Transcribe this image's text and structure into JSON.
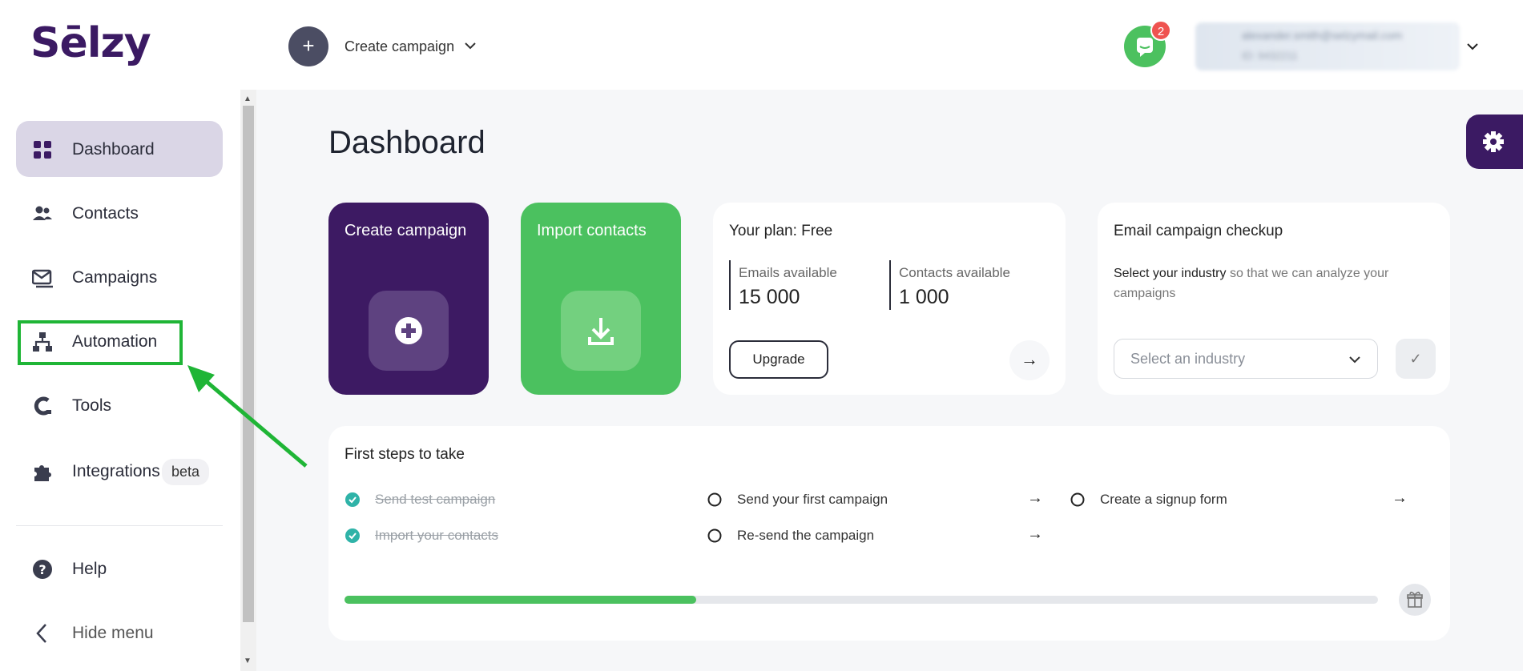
{
  "app": {
    "logo_text": "Sēlzy",
    "brand_color": "#3b1a63",
    "accent_green": "#4bc15f"
  },
  "header": {
    "create_campaign_label": "Create campaign",
    "notifications_count": "2",
    "user_email": "alexander.smith@selzymail.com",
    "user_plan": "ID: 9432211"
  },
  "sidebar": {
    "items": [
      {
        "label": "Dashboard",
        "icon": "dashboard-icon",
        "active": true
      },
      {
        "label": "Contacts",
        "icon": "contacts-icon"
      },
      {
        "label": "Campaigns",
        "icon": "campaigns-icon"
      },
      {
        "label": "Automation",
        "icon": "automation-icon"
      },
      {
        "label": "Tools",
        "icon": "tools-icon"
      },
      {
        "label": "Integrations",
        "icon": "integrations-icon",
        "badge": "beta"
      },
      {
        "label": "Help",
        "icon": "help-icon"
      },
      {
        "label": "Hide menu",
        "icon": "chevron-left-icon"
      }
    ]
  },
  "main": {
    "title": "Dashboard",
    "create_card": {
      "title": "Create campaign"
    },
    "import_card": {
      "title": "Import contacts"
    },
    "plan_card": {
      "title": "Your plan: Free",
      "emails_label": "Emails available",
      "emails_value": "15 000",
      "contacts_label": "Contacts available",
      "contacts_value": "1 000",
      "upgrade_label": "Upgrade",
      "arrow": "→"
    },
    "checkup_card": {
      "title": "Email campaign checkup",
      "desc_strong": "Select your industry",
      "desc_rest": " so that we can analyze your campaigns",
      "select_placeholder": "Select an industry",
      "confirm_icon": "✓"
    },
    "steps": {
      "title": "First steps to take",
      "items": [
        {
          "label": "Send test campaign",
          "done": true
        },
        {
          "label": "Import your contacts",
          "done": true
        },
        {
          "label": "Send your first campaign",
          "done": false,
          "arrow": "→"
        },
        {
          "label": "Re-send the campaign",
          "done": false,
          "arrow": "→"
        },
        {
          "label": "Create a signup form",
          "done": false,
          "arrow": "→"
        }
      ],
      "progress_percent": 34
    }
  }
}
